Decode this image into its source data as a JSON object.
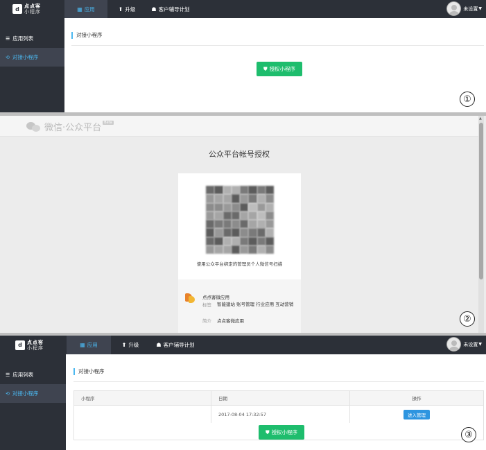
{
  "app": {
    "logo_line1": "点点客",
    "logo_line2": "小程序",
    "nav_tabs": [
      "应用",
      "升级",
      "客户辅导计划"
    ],
    "user_name": "未设置",
    "sidebar_items": [
      "应用列表",
      "对接小程序"
    ],
    "page_title": "对接小程序",
    "authorize_button": "授权小程序"
  },
  "step_labels": [
    "①",
    "②",
    "③"
  ],
  "wechat": {
    "brand": "微信·公众平台",
    "beta": "Beta",
    "title": "公众平台帐号授权",
    "scan_hint": "使用公众平台绑定的管理员个人微信号扫描",
    "app_name": "点点客微应用",
    "tags_label": "标签",
    "tags_value": "智能建站 账号管理 行业应用 互动营销",
    "intro_label": "简介",
    "intro_value": "点点客微应用"
  },
  "table": {
    "headers": [
      "小程序",
      "日期",
      "操作"
    ],
    "rows": [
      {
        "name": "",
        "date": "2017-08-04 17:32:57",
        "action": "进入管理"
      }
    ]
  },
  "colors": {
    "topbar": "#2c3038",
    "accent_blue": "#4bb8f0",
    "green": "#1ebd6d",
    "button_blue": "#2d95e0"
  }
}
